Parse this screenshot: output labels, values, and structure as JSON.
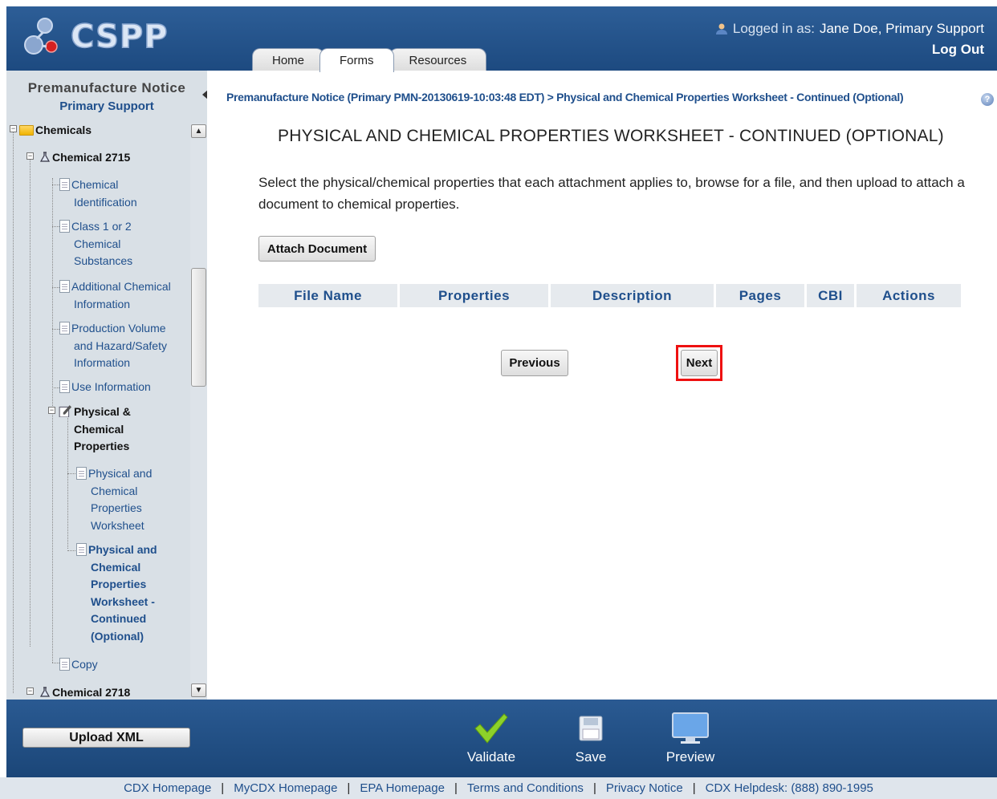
{
  "app": {
    "logo_text": "CSPP"
  },
  "user": {
    "logged_in_label": "Logged in as:",
    "name": "Jane Doe, Primary Support",
    "logout": "Log Out"
  },
  "tabs": [
    {
      "label": "Home"
    },
    {
      "label": "Forms",
      "active": true
    },
    {
      "label": "Resources"
    }
  ],
  "sidebar": {
    "title": "Premanufacture Notice",
    "subtitle": "Primary Support",
    "tree": {
      "chemicals": "Chemicals",
      "chemical1": "Chemical 2715",
      "item1": [
        "Chemical",
        "Identification"
      ],
      "item2": [
        "Class 1 or 2",
        "Chemical",
        "Substances"
      ],
      "item3": [
        "Additional Chemical",
        "Information"
      ],
      "item4": [
        "Production Volume",
        "and Hazard/Safety",
        "Information"
      ],
      "item5": [
        "Use Information"
      ],
      "item6": [
        "Physical &",
        "Chemical",
        "Properties"
      ],
      "item7": [
        "Physical and",
        "Chemical",
        "Properties",
        "Worksheet"
      ],
      "item8": [
        "Physical and",
        "Chemical",
        "Properties",
        "Worksheet -",
        "Continued",
        "(Optional)"
      ],
      "item9": [
        "Copy"
      ],
      "chemical2": "Chemical 2718"
    }
  },
  "main": {
    "breadcrumb": "Premanufacture Notice (Primary PMN-20130619-10:03:48 EDT) > Physical and Chemical Properties Worksheet - Continued (Optional)",
    "title": "PHYSICAL AND CHEMICAL PROPERTIES WORKSHEET - CONTINUED (OPTIONAL)",
    "instructions": "Select the physical/chemical properties that each attachment applies to, browse for a file, and then upload to attach a document to chemical properties.",
    "attach_button": "Attach Document",
    "columns": [
      "File Name",
      "Properties",
      "Description",
      "Pages",
      "CBI",
      "Actions"
    ],
    "previous_button": "Previous",
    "next_button": "Next"
  },
  "footer": {
    "upload_button": "Upload XML",
    "validate": "Validate",
    "save": "Save",
    "preview": "Preview"
  },
  "links": [
    "CDX Homepage",
    "MyCDX Homepage",
    "EPA Homepage",
    "Terms and Conditions",
    "Privacy Notice",
    "CDX Helpdesk: (888) 890-1995"
  ],
  "colors": {
    "header_blue": "#1d4a80",
    "link_blue": "#1f4f8c",
    "highlight_red": "#ee1111"
  }
}
